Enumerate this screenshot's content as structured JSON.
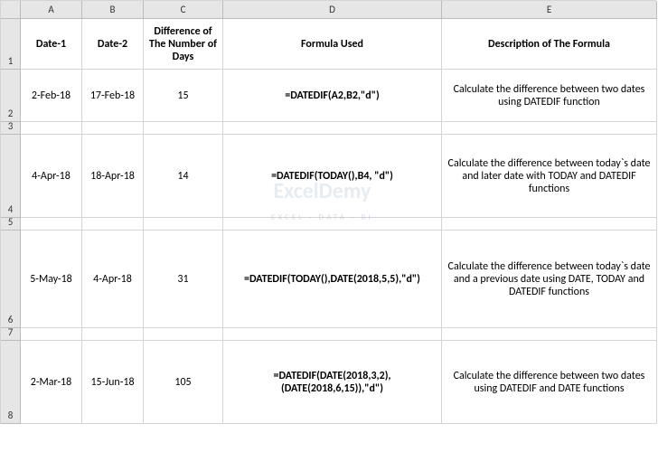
{
  "columns": [
    "A",
    "B",
    "C",
    "D",
    "E"
  ],
  "headers": {
    "A": "Date-1",
    "B": "Date-2",
    "C": "Difference of The Number of Days",
    "D": "Formula Used",
    "E": "Description of The Formula"
  },
  "rows": {
    "2": {
      "A": "2-Feb-18",
      "B": "17-Feb-18",
      "C": "15",
      "D": "=DATEDIF(A2,B2,\"d\")",
      "E": "Calculate the difference between two dates using DATEDIF function"
    },
    "4": {
      "A": "4-Apr-18",
      "B": "18-Apr-18",
      "C": "14",
      "D": "=DATEDIF(TODAY(),B4, \"d\")",
      "E": "Calculate the difference between today`s date and later date with TODAY and DATEDIF functions"
    },
    "6": {
      "A": "5-May-18",
      "B": "4-Apr-18",
      "C": "31",
      "D": "=DATEDIF(TODAY(),DATE(2018,5,5),\"d\")",
      "E": "Calculate the difference between today`s date and a previous date using DATE, TODAY and DATEDIF functions"
    },
    "8": {
      "A": "2-Mar-18",
      "B": "15-Jun-18",
      "C": "105",
      "D": "=DATEDIF(DATE(2018,3,2),(DATE(2018,6,15)),\"d\")",
      "E": "Calculate the difference between two dates using DATEDIF and DATE functions"
    }
  },
  "row_heights": {
    "1": 56,
    "2": 58,
    "3": 14,
    "4": 92,
    "5": 14,
    "6": 108,
    "7": 14,
    "8": 92
  },
  "watermark": {
    "main": "ExcelDemy",
    "sub": "EXCEL · DATA · BI"
  },
  "chart_data": {
    "type": "table",
    "title": "",
    "columns": [
      "Date-1",
      "Date-2",
      "Difference of The Number of Days",
      "Formula Used",
      "Description of The Formula"
    ],
    "data": [
      [
        "2-Feb-18",
        "17-Feb-18",
        15,
        "=DATEDIF(A2,B2,\"d\")",
        "Calculate the difference between two dates using DATEDIF function"
      ],
      [
        "4-Apr-18",
        "18-Apr-18",
        14,
        "=DATEDIF(TODAY(),B4, \"d\")",
        "Calculate the difference between today`s date and later date with TODAY and DATEDIF functions"
      ],
      [
        "5-May-18",
        "4-Apr-18",
        31,
        "=DATEDIF(TODAY(),DATE(2018,5,5),\"d\")",
        "Calculate the difference between today`s date and a previous date using DATE, TODAY and DATEDIF functions"
      ],
      [
        "2-Mar-18",
        "15-Jun-18",
        105,
        "=DATEDIF(DATE(2018,3,2),(DATE(2018,6,15)),\"d\")",
        "Calculate the difference between two dates using DATEDIF and DATE functions"
      ]
    ]
  }
}
